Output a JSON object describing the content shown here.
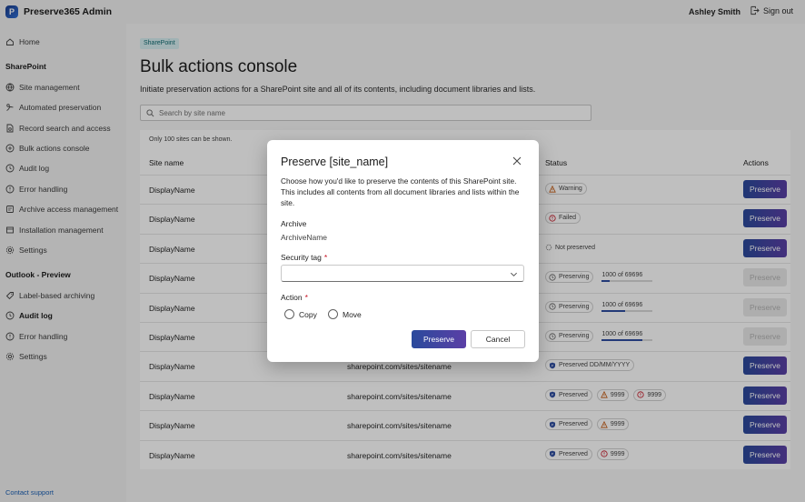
{
  "app": {
    "title": "Preserve365 Admin",
    "logo_letter": "P",
    "user_name": "Ashley Smith",
    "sign_out": "Sign out"
  },
  "sidebar": {
    "home": "Home",
    "section_sharepoint": "SharePoint",
    "sharepoint_items": [
      {
        "label": "Site management",
        "icon": "globe-icon"
      },
      {
        "label": "Automated preservation",
        "icon": "automation-icon"
      },
      {
        "label": "Record search and access",
        "icon": "search-access-icon"
      },
      {
        "label": "Bulk actions console",
        "icon": "bulk-icon"
      },
      {
        "label": "Audit log",
        "icon": "history-icon"
      },
      {
        "label": "Error handling",
        "icon": "error-icon"
      },
      {
        "label": "Archive access management",
        "icon": "archive-access-icon"
      },
      {
        "label": "Installation management",
        "icon": "installation-icon"
      },
      {
        "label": "Settings",
        "icon": "gear-icon"
      }
    ],
    "section_outlook": "Outlook - Preview",
    "outlook_items": [
      {
        "label": "Label-based archiving",
        "icon": "tag-icon"
      },
      {
        "label": "Audit log",
        "icon": "history-icon"
      },
      {
        "label": "Error handling",
        "icon": "error-icon"
      },
      {
        "label": "Settings",
        "icon": "gear-icon"
      }
    ],
    "contact": "Contact support"
  },
  "main": {
    "chip": "SharePoint",
    "title": "Bulk actions console",
    "description": "Initiate preservation actions for a SharePoint site and all of its contents, including document libraries and lists.",
    "search_placeholder": "Search by site name",
    "note": "Only 100 sites can be shown.",
    "columns": {
      "site_name": "Site name",
      "status": "Status",
      "actions": "Actions"
    },
    "action_label": "Preserve",
    "rows": [
      {
        "name": "DisplayName",
        "url": "",
        "status": [
          {
            "text": "Warning",
            "kind": "warning"
          }
        ],
        "disabled": false
      },
      {
        "name": "DisplayName",
        "url": "",
        "status": [
          {
            "text": "Failed",
            "kind": "error"
          }
        ],
        "disabled": false
      },
      {
        "name": "DisplayName",
        "url": "",
        "status": [
          {
            "text": "Not preserved",
            "kind": "plain"
          }
        ],
        "disabled": false
      },
      {
        "name": "DisplayName",
        "url": "",
        "status": [
          {
            "text": "Preserving",
            "kind": "clock"
          }
        ],
        "progress": {
          "text": "1000 of 69696",
          "fraction": 0.15
        },
        "disabled": true
      },
      {
        "name": "DisplayName",
        "url": "",
        "status": [
          {
            "text": "Preserving",
            "kind": "clock"
          }
        ],
        "progress": {
          "text": "1000 of 69696",
          "fraction": 0.45
        },
        "disabled": true
      },
      {
        "name": "DisplayName",
        "url": "",
        "status": [
          {
            "text": "Preserving",
            "kind": "clock"
          }
        ],
        "progress": {
          "text": "1000 of 69696",
          "fraction": 0.8
        },
        "disabled": true
      },
      {
        "name": "DisplayName",
        "url": "sharepoint.com/sites/sitename",
        "status": [
          {
            "text": "Preserved DD/MM/YYYY",
            "kind": "preserved"
          }
        ],
        "disabled": false
      },
      {
        "name": "DisplayName",
        "url": "sharepoint.com/sites/sitename",
        "status": [
          {
            "text": "Preserved",
            "kind": "preserved"
          },
          {
            "text": "9999",
            "kind": "warning"
          },
          {
            "text": "9999",
            "kind": "error"
          }
        ],
        "disabled": false
      },
      {
        "name": "DisplayName",
        "url": "sharepoint.com/sites/sitename",
        "status": [
          {
            "text": "Preserved",
            "kind": "preserved"
          },
          {
            "text": "9999",
            "kind": "warning"
          }
        ],
        "disabled": false
      },
      {
        "name": "DisplayName",
        "url": "sharepoint.com/sites/sitename",
        "status": [
          {
            "text": "Preserved",
            "kind": "preserved"
          },
          {
            "text": "9999",
            "kind": "error"
          }
        ],
        "disabled": false
      }
    ]
  },
  "dialog": {
    "title": "Preserve [site_name]",
    "description": "Choose how you'd like to preserve the contents of this SharePoint site. This includes all contents from all document libraries and lists within the site.",
    "archive_label": "Archive",
    "archive_value": "ArchiveName",
    "security_tag_label": "Security tag",
    "security_tag_value": "",
    "required_mark": "*",
    "action_label": "Action",
    "options": [
      "Copy",
      "Move"
    ],
    "primary_button": "Preserve",
    "secondary_button": "Cancel"
  },
  "colors": {
    "accent_start": "#2a4a9c",
    "accent_end": "#5b3fa6",
    "warning": "#c55a11",
    "error": "#c50f1f",
    "preserved": "#2f4ea1",
    "progress_fill": "#2f4ea1"
  }
}
